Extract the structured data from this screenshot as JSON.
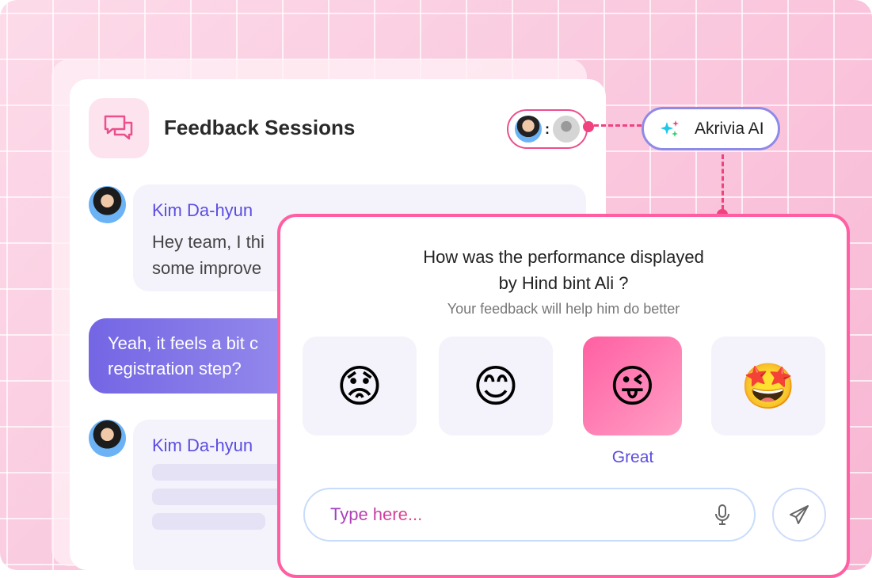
{
  "header": {
    "title": "Feedback Sessions",
    "icon": "chat-bubbles-icon"
  },
  "ai_badge": {
    "label": "Akrivia AI",
    "icon": "sparkles-icon"
  },
  "chat": {
    "messages": [
      {
        "author": "Kim Da-hyun",
        "text": "Hey team, I thi\nsome improve"
      },
      {
        "text": "Yeah, it feels a bit c\nregistration step?"
      },
      {
        "author": "Kim Da-hyun"
      }
    ]
  },
  "feedback": {
    "question": "How was the performance displayed\nby Hind bint Ali ?",
    "subtitle": "Your feedback will help him do better",
    "options": [
      {
        "emoji": "😟"
      },
      {
        "emoji": "😊"
      },
      {
        "emoji": "😜",
        "selected": true
      },
      {
        "emoji": "🤩"
      }
    ],
    "selected_label": "Great",
    "input_placeholder": "Type here..."
  },
  "colors": {
    "accent_pink": "#ff5fa2",
    "accent_purple": "#5b4de0"
  }
}
